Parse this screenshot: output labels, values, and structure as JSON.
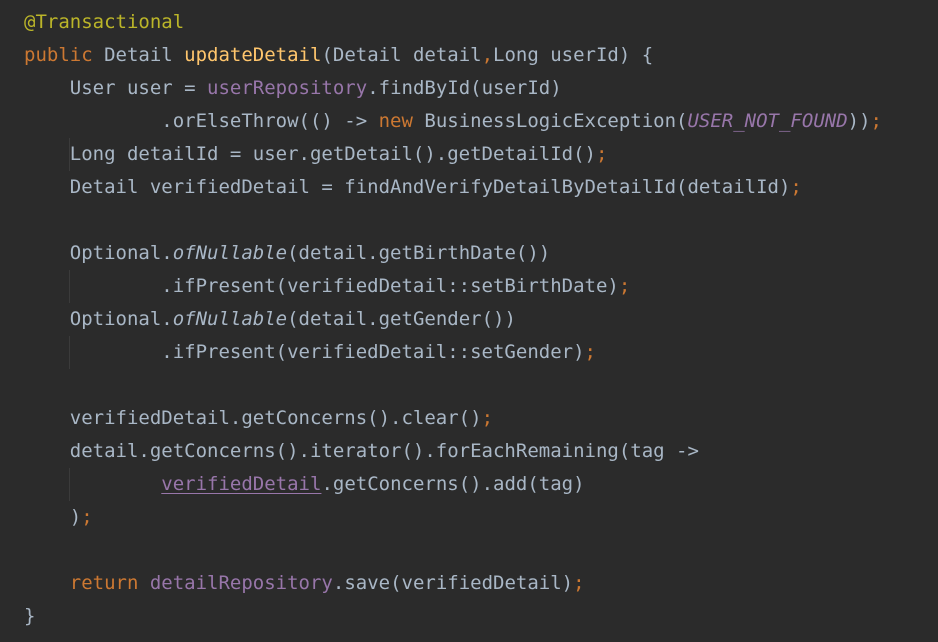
{
  "editor": {
    "language": "Java",
    "theme": "Darcula",
    "colors": {
      "background": "#2b2b2b",
      "text": "#a9b7c6",
      "keyword": "#cc7832",
      "annotation": "#bbb529",
      "method_declaration": "#ffc66d",
      "field": "#9876aa"
    },
    "lines": [
      [
        {
          "t": "@Transactional",
          "c": "annotation"
        }
      ],
      [
        {
          "t": "public ",
          "c": "keyword"
        },
        {
          "t": "Detail ",
          "c": "plain"
        },
        {
          "t": "updateDetail",
          "c": "method-decl"
        },
        {
          "t": "(Detail detail",
          "c": "plain"
        },
        {
          "t": ",",
          "c": "punct"
        },
        {
          "t": "Long userId) {",
          "c": "plain"
        }
      ],
      [
        {
          "t": "    User user = ",
          "c": "plain"
        },
        {
          "t": "userRepository",
          "c": "field"
        },
        {
          "t": ".findById(userId)",
          "c": "plain"
        }
      ],
      [
        {
          "t": "            .orElseThrow(() -> ",
          "c": "plain"
        },
        {
          "t": "new ",
          "c": "keyword"
        },
        {
          "t": "BusinessLogicException(",
          "c": "plain"
        },
        {
          "t": "USER_NOT_FOUND",
          "c": "constant"
        },
        {
          "t": "))",
          "c": "plain"
        },
        {
          "t": ";",
          "c": "punct"
        }
      ],
      [
        {
          "t": "    Long detailId = user.getDetail().getDetailId()",
          "c": "plain"
        },
        {
          "t": ";",
          "c": "punct"
        }
      ],
      [
        {
          "t": "    Detail verifiedDetail = findAndVerifyDetailByDetailId(detailId)",
          "c": "plain"
        },
        {
          "t": ";",
          "c": "punct"
        }
      ],
      [
        {
          "t": "",
          "c": "plain"
        }
      ],
      [
        {
          "t": "    Optional.",
          "c": "plain"
        },
        {
          "t": "ofNullable",
          "c": "static"
        },
        {
          "t": "(detail.getBirthDate())",
          "c": "plain"
        }
      ],
      [
        {
          "t": "            .ifPresent(verifiedDetail::setBirthDate)",
          "c": "plain"
        },
        {
          "t": ";",
          "c": "punct"
        }
      ],
      [
        {
          "t": "    Optional.",
          "c": "plain"
        },
        {
          "t": "ofNullable",
          "c": "static"
        },
        {
          "t": "(detail.getGender())",
          "c": "plain"
        }
      ],
      [
        {
          "t": "            .ifPresent(verifiedDetail::setGender)",
          "c": "plain"
        },
        {
          "t": ";",
          "c": "punct"
        }
      ],
      [
        {
          "t": "",
          "c": "plain"
        }
      ],
      [
        {
          "t": "    verifiedDetail.getConcerns().clear()",
          "c": "plain"
        },
        {
          "t": ";",
          "c": "punct"
        }
      ],
      [
        {
          "t": "    detail.getConcerns().iterator().forEachRemaining(tag ->",
          "c": "plain"
        }
      ],
      [
        {
          "t": "            ",
          "c": "plain"
        },
        {
          "t": "verifiedDetail",
          "c": "underline"
        },
        {
          "t": ".getConcerns().add(tag)",
          "c": "plain"
        }
      ],
      [
        {
          "t": "    )",
          "c": "plain"
        },
        {
          "t": ";",
          "c": "punct"
        }
      ],
      [
        {
          "t": "",
          "c": "plain"
        }
      ],
      [
        {
          "t": "    ",
          "c": "plain"
        },
        {
          "t": "return ",
          "c": "keyword"
        },
        {
          "t": "detailRepository",
          "c": "field"
        },
        {
          "t": ".save(verifiedDetail)",
          "c": "plain"
        },
        {
          "t": ";",
          "c": "punct"
        }
      ],
      [
        {
          "t": "}",
          "c": "plain"
        }
      ]
    ]
  }
}
